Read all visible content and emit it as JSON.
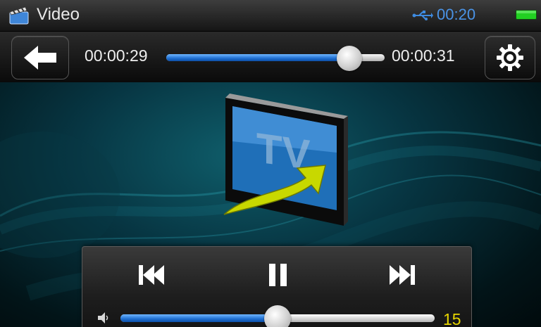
{
  "status_bar": {
    "app_title": "Video",
    "app_icon": "clapperboard-icon",
    "usb_icon": "usb-icon",
    "clock": "00:20",
    "battery_icon": "battery-icon",
    "clock_color": "#4a93e6",
    "battery_color": "#22d022"
  },
  "toolbar": {
    "back_icon": "arrow-left-icon",
    "settings_icon": "gear-icon",
    "elapsed": "00:00:29",
    "remaining": "00:00:31",
    "progress": 0.84,
    "accent_color": "#1f6fd1"
  },
  "main": {
    "artwork_icon": "tv-icon",
    "artwork_text": "TV",
    "arrow_color": "#c8d800"
  },
  "controls": {
    "prev_icon": "skip-previous-icon",
    "pause_icon": "pause-icon",
    "next_icon": "skip-next-icon",
    "volume_icon": "speaker-icon",
    "volume_value": "15",
    "volume_level": 0.5,
    "volume_value_color": "#e8d600"
  }
}
